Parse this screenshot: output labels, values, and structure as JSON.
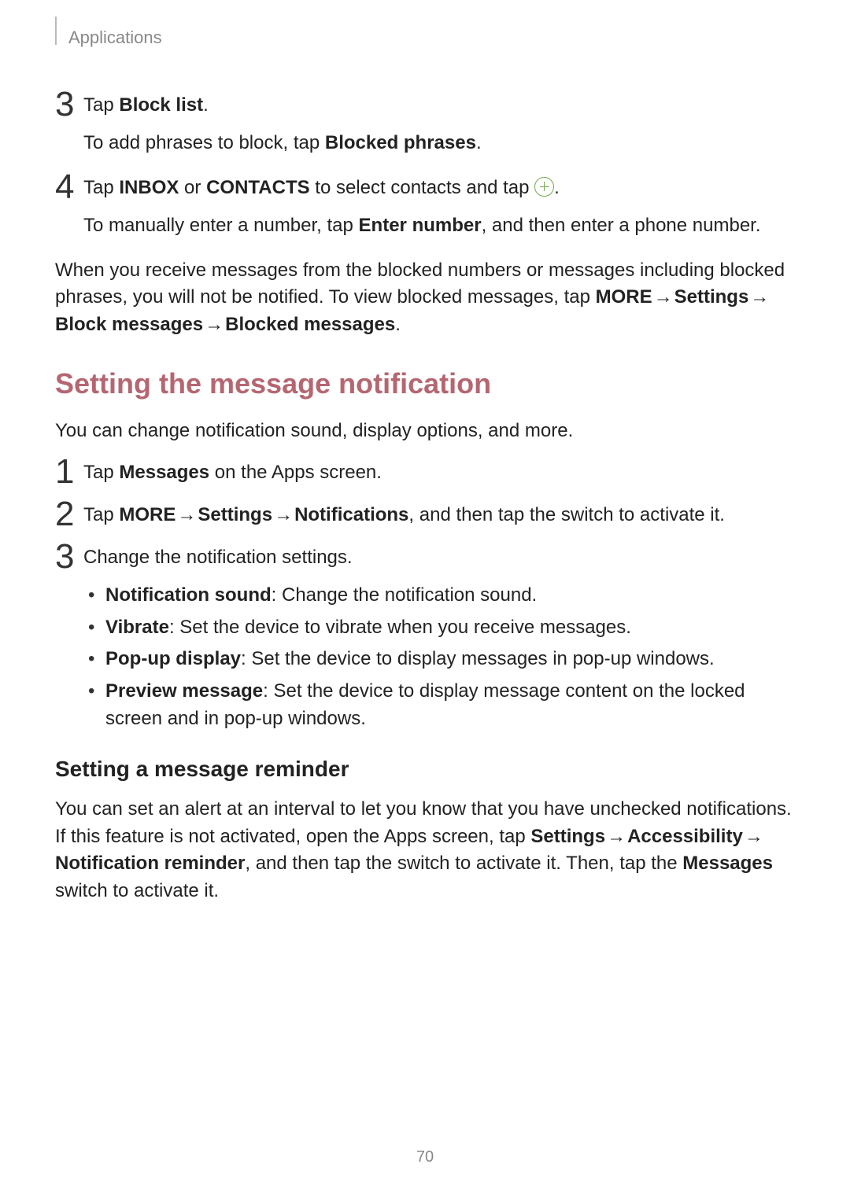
{
  "header": {
    "section": "Applications"
  },
  "step3": {
    "label": "3",
    "pre": "Tap ",
    "bold": "Block list",
    "post": ".",
    "sub_pre": "To add phrases to block, tap ",
    "sub_bold": "Blocked phrases",
    "sub_post": "."
  },
  "step4": {
    "label": "4",
    "pre": "Tap ",
    "b1": "INBOX",
    "mid1": " or ",
    "b2": "CONTACTS",
    "mid2": " to select contacts and tap ",
    "post": ".",
    "sub_pre": "To manually enter a number, tap ",
    "sub_bold": "Enter number",
    "sub_post": ", and then enter a phone number."
  },
  "para1": {
    "t1": "When you receive messages from the blocked numbers or messages including blocked phrases, you will not be notified. To view blocked messages, tap ",
    "b1": "MORE",
    "t2": " → ",
    "b2": "Settings",
    "t3": " → ",
    "b3": "Block messages",
    "t4": " → ",
    "b4": "Blocked messages",
    "t5": "."
  },
  "heading2": "Setting the message notification",
  "para2": "You can change notification sound, display options, and more.",
  "s1": {
    "label": "1",
    "pre": "Tap ",
    "bold": "Messages",
    "post": " on the Apps screen."
  },
  "s2": {
    "label": "2",
    "pre": "Tap ",
    "b1": "MORE",
    "t1": " → ",
    "b2": "Settings",
    "t2": " → ",
    "b3": "Notifications",
    "post": ", and then tap the switch to activate it."
  },
  "s3": {
    "label": "3",
    "text": "Change the notification settings.",
    "items": [
      {
        "b": "Notification sound",
        "rest": ": Change the notification sound."
      },
      {
        "b": "Vibrate",
        "rest": ": Set the device to vibrate when you receive messages."
      },
      {
        "b": "Pop-up display",
        "rest": ": Set the device to display messages in pop-up windows."
      },
      {
        "b": "Preview message",
        "rest": ": Set the device to display message content on the locked screen and in pop-up windows."
      }
    ]
  },
  "heading3": "Setting a message reminder",
  "para3": {
    "t1": "You can set an alert at an interval to let you know that you have unchecked notifications. If this feature is not activated, open the Apps screen, tap ",
    "b1": "Settings",
    "t2": " → ",
    "b2": "Accessibility",
    "t3": " → ",
    "b3": "Notification reminder",
    "t4": ", and then tap the switch to activate it. Then, tap the ",
    "b4": "Messages",
    "t5": " switch to activate it."
  },
  "pageNumber": "70"
}
